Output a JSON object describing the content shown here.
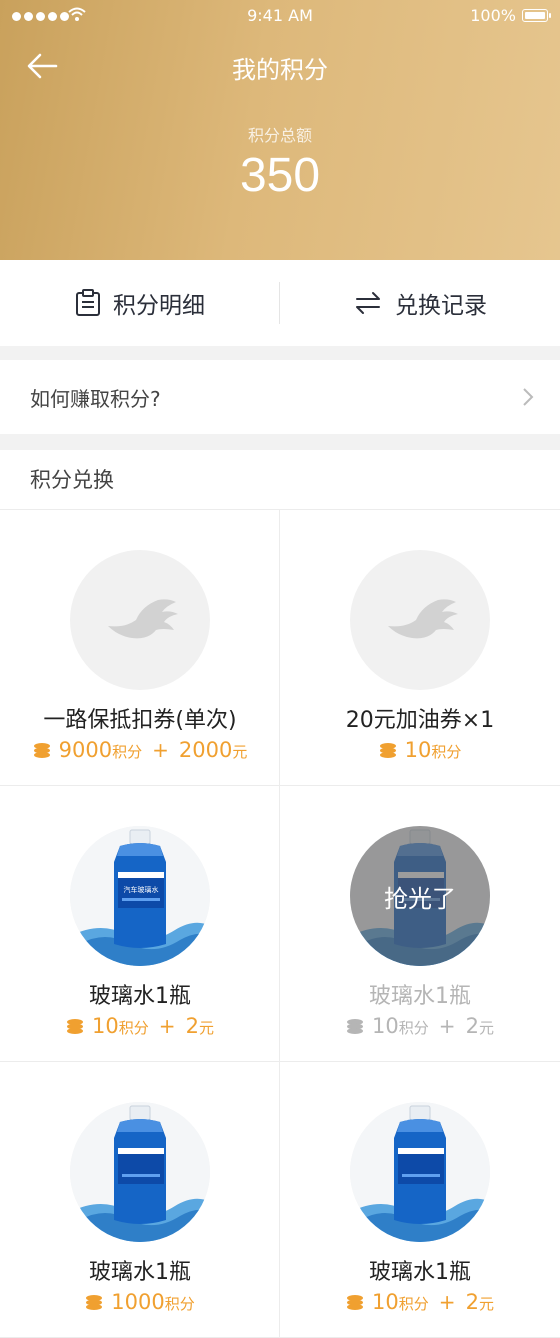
{
  "status_bar": {
    "time": "9:41 AM",
    "battery": "100%"
  },
  "header": {
    "title": "我的积分",
    "total_label": "积分总额",
    "total_value": "350"
  },
  "tabs": [
    {
      "label": "积分明细",
      "icon": "clipboard-icon"
    },
    {
      "label": "兑换记录",
      "icon": "swap-arrows-icon"
    }
  ],
  "earn": {
    "label": "如何赚取积分?"
  },
  "exchange": {
    "title": "积分兑换",
    "items": [
      {
        "name": "一路保抵扣券(单次)",
        "points": "9000",
        "points_unit": "积分",
        "plus": "+",
        "cash": "2000",
        "cash_unit": "元",
        "image": "placeholder-bird-icon",
        "sold_out": false
      },
      {
        "name": "20元加油券×1",
        "points": "10",
        "points_unit": "积分",
        "image": "placeholder-bird-icon",
        "sold_out": false
      },
      {
        "name": "玻璃水1瓶",
        "points": "10",
        "points_unit": "积分",
        "plus": "+",
        "cash": "2",
        "cash_unit": "元",
        "image": "washer-fluid-bottle",
        "sold_out": false
      },
      {
        "name": "玻璃水1瓶",
        "points": "10",
        "points_unit": "积分",
        "plus": "+",
        "cash": "2",
        "cash_unit": "元",
        "image": "washer-fluid-bottle",
        "sold_out": true,
        "sold_out_label": "抢光了"
      },
      {
        "name": "玻璃水1瓶",
        "points": "1000",
        "points_unit": "积分",
        "image": "washer-fluid-bottle",
        "sold_out": false
      },
      {
        "name": "玻璃水1瓶",
        "points": "10",
        "points_unit": "积分",
        "plus": "+",
        "cash": "2",
        "cash_unit": "元",
        "image": "washer-fluid-bottle",
        "sold_out": false
      }
    ],
    "bottle_label": "汽车玻璃水"
  },
  "colors": {
    "header_start": "#c9a15c",
    "header_end": "#e6c68f",
    "accent": "#f0a030",
    "disabled": "#b5b5b5"
  }
}
